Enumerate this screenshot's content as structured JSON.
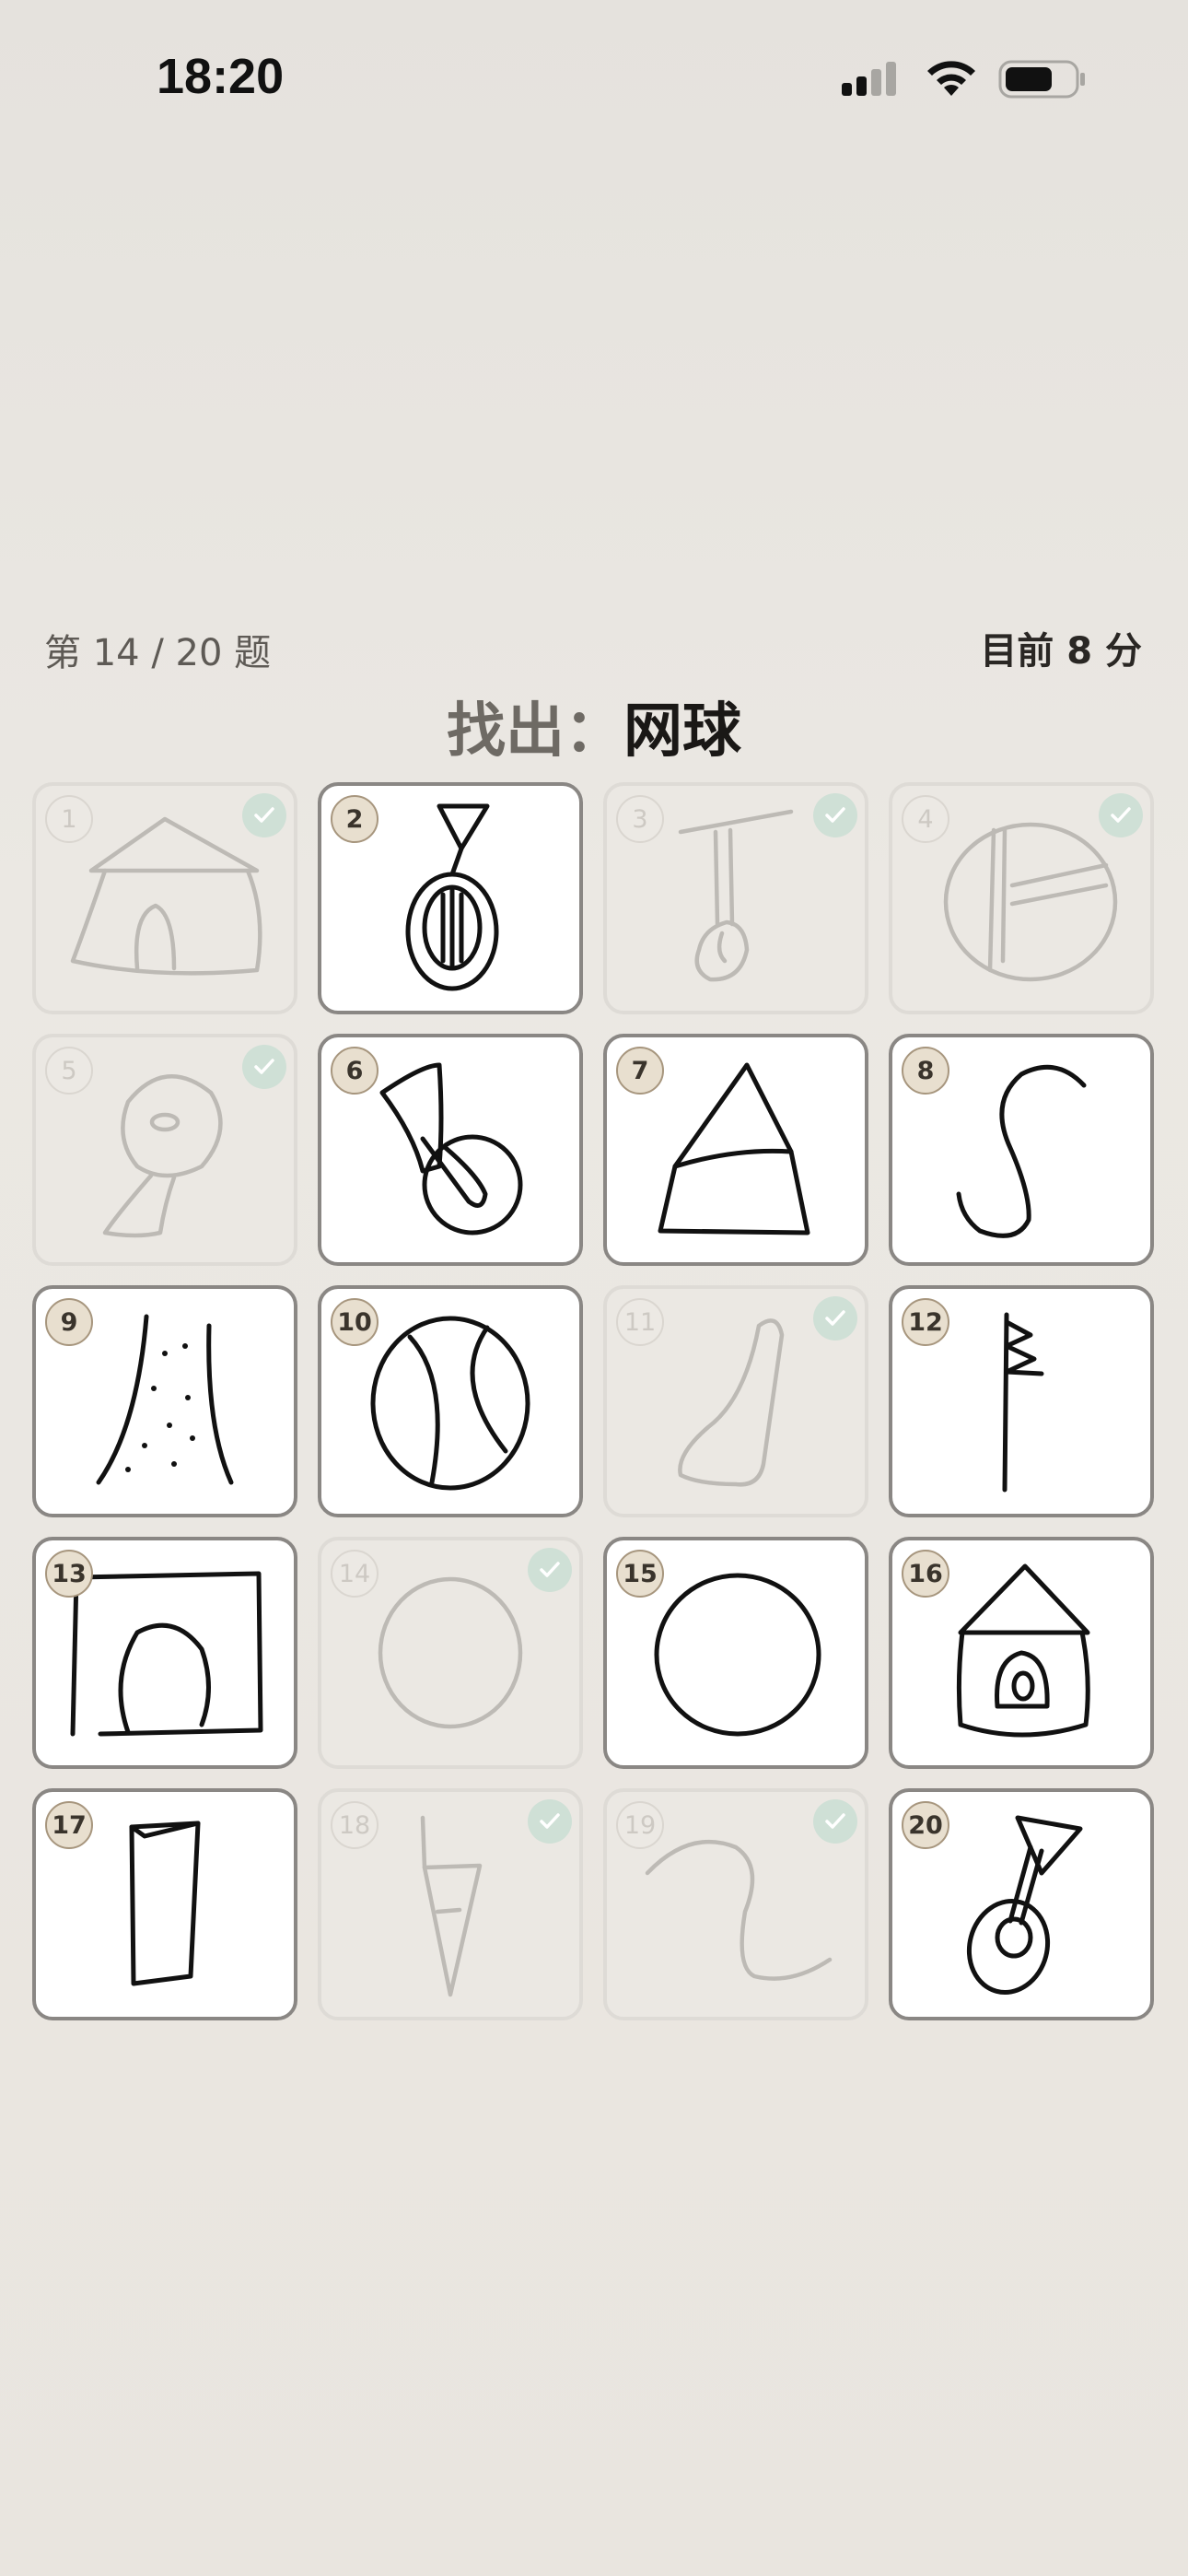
{
  "status_bar": {
    "time": "18:20",
    "icons": [
      "cellular-signal-icon",
      "wifi-icon",
      "battery-icon"
    ]
  },
  "header": {
    "progress": "第 14 / 20 题",
    "score": "目前 8 分",
    "prompt_prefix": "找出：",
    "prompt_target": "网球"
  },
  "cards": [
    {
      "number": "1",
      "completed": true,
      "drawing": "house-sketch"
    },
    {
      "number": "2",
      "completed": false,
      "drawing": "racket-sketch"
    },
    {
      "number": "3",
      "completed": true,
      "drawing": "hammer-sketch"
    },
    {
      "number": "4",
      "completed": true,
      "drawing": "circle-with-lines-sketch"
    },
    {
      "number": "5",
      "completed": true,
      "drawing": "mushroom-sketch"
    },
    {
      "number": "6",
      "completed": false,
      "drawing": "trumpet-ball-sketch"
    },
    {
      "number": "7",
      "completed": false,
      "drawing": "cone-sketch"
    },
    {
      "number": "8",
      "completed": false,
      "drawing": "s-curve-sketch"
    },
    {
      "number": "9",
      "completed": false,
      "drawing": "tree-trunk-sketch"
    },
    {
      "number": "10",
      "completed": false,
      "drawing": "tennis-ball-sketch"
    },
    {
      "number": "11",
      "completed": true,
      "drawing": "boot-sketch"
    },
    {
      "number": "12",
      "completed": false,
      "drawing": "branch-sketch"
    },
    {
      "number": "13",
      "completed": false,
      "drawing": "square-circle-sketch"
    },
    {
      "number": "14",
      "completed": true,
      "drawing": "circle-sketch"
    },
    {
      "number": "15",
      "completed": false,
      "drawing": "circle-sketch"
    },
    {
      "number": "16",
      "completed": false,
      "drawing": "house-sketch"
    },
    {
      "number": "17",
      "completed": false,
      "drawing": "box-sketch"
    },
    {
      "number": "18",
      "completed": true,
      "drawing": "carrot-sketch"
    },
    {
      "number": "19",
      "completed": true,
      "drawing": "wave-sketch"
    },
    {
      "number": "20",
      "completed": false,
      "drawing": "guitar-sketch"
    }
  ]
}
